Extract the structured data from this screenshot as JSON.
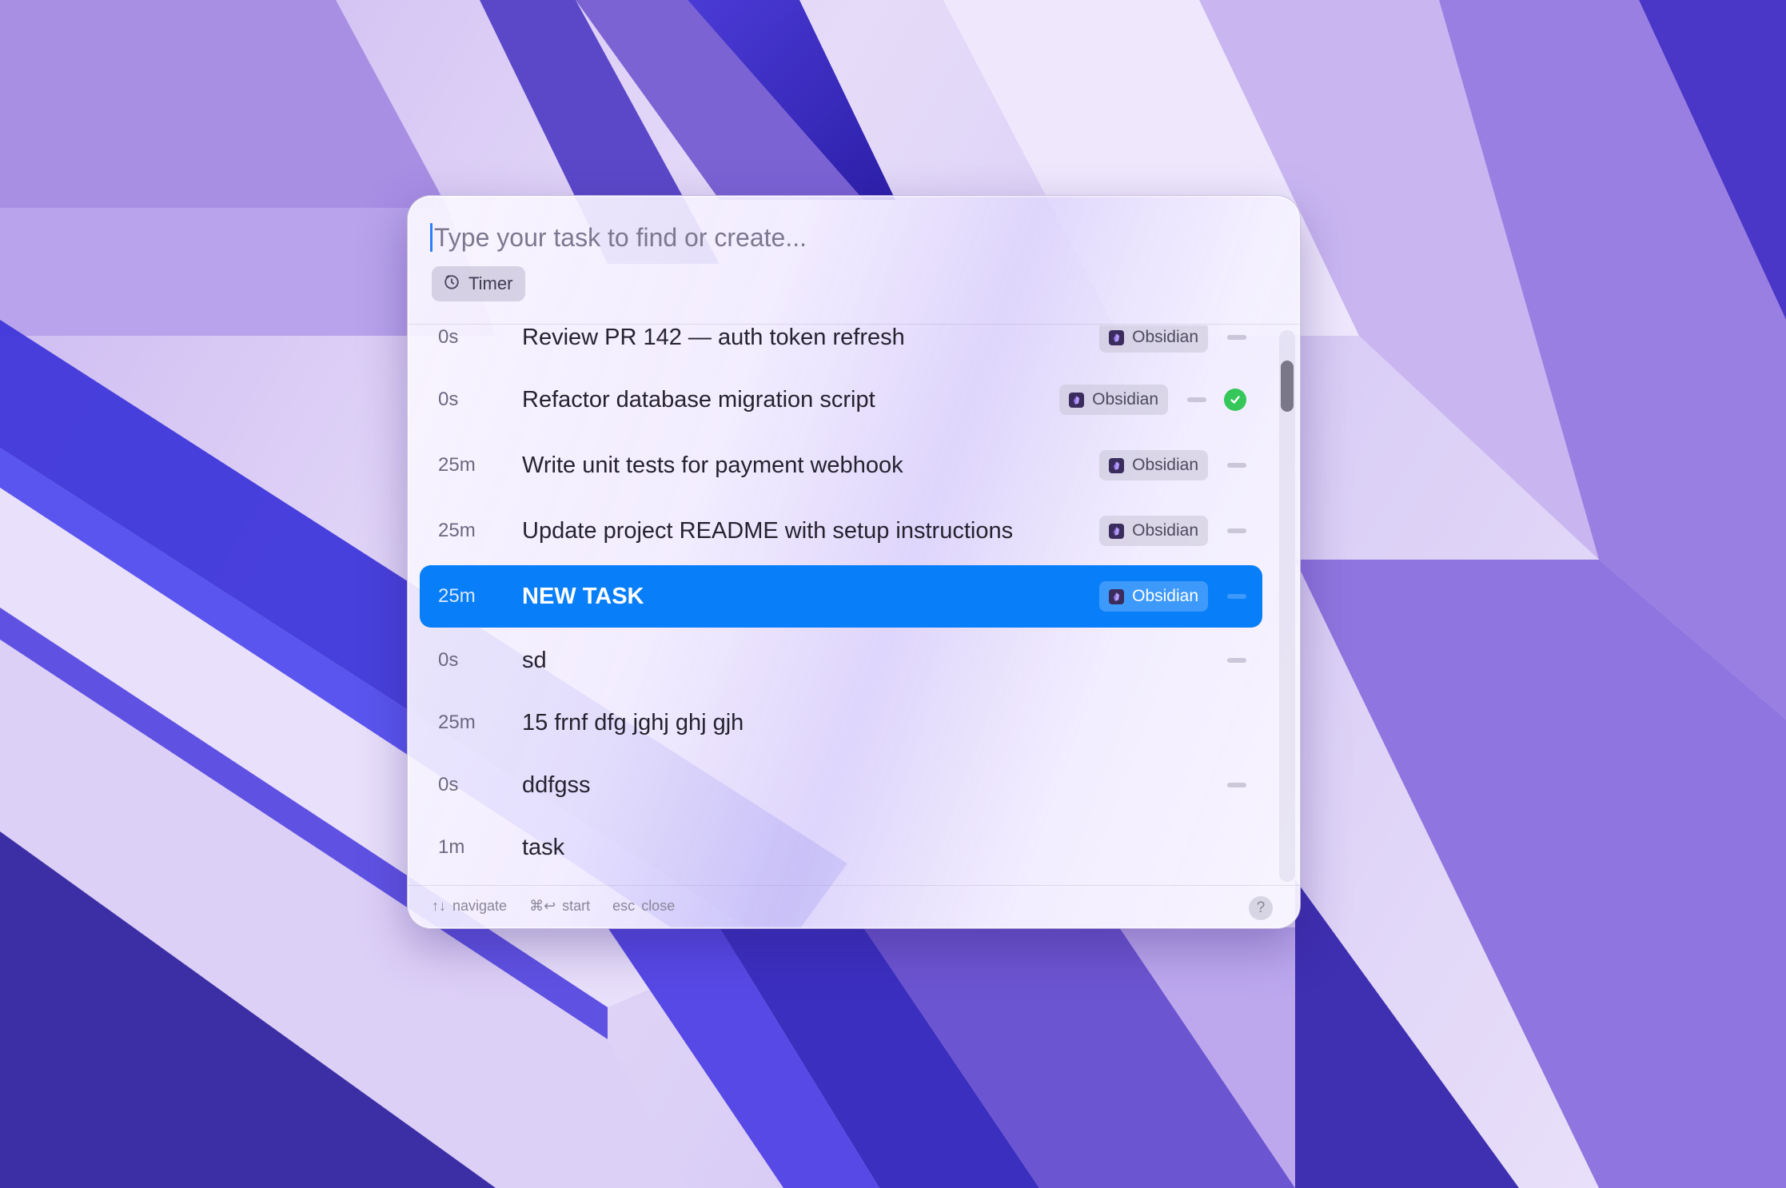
{
  "search": {
    "placeholder": "Type your task to find or create..."
  },
  "chip": {
    "label": "Timer",
    "icon": "timer-icon"
  },
  "tasks": [
    {
      "duration": "0s",
      "title": "Review PR 142 — auth token refresh",
      "tag": "Obsidian",
      "status": "dash"
    },
    {
      "duration": "0s",
      "title": "Refactor database migration script",
      "tag": "Obsidian",
      "status": "done"
    },
    {
      "duration": "25m",
      "title": "Write unit tests for payment webhook",
      "tag": "Obsidian",
      "status": "dash"
    },
    {
      "duration": "25m",
      "title": "Update project README with setup instructions",
      "tag": "Obsidian",
      "status": "dash"
    },
    {
      "duration": "25m",
      "title": "NEW TASK",
      "tag": "Obsidian",
      "status": "dash",
      "selected": true
    },
    {
      "duration": "0s",
      "title": "sd",
      "tag": "",
      "status": "dash"
    },
    {
      "duration": "25m",
      "title": "15 frnf dfg jghj ghj gjh",
      "tag": "",
      "status": "none"
    },
    {
      "duration": "0s",
      "title": "ddfgss",
      "tag": "",
      "status": "dash"
    },
    {
      "duration": "1m",
      "title": "task",
      "tag": "",
      "status": "none"
    }
  ],
  "footer": {
    "navigate_keys": "↑↓",
    "navigate_label": "navigate",
    "start_keys": "⌘↩",
    "start_label": "start",
    "close_keys": "esc",
    "close_label": "close",
    "help_label": "?"
  },
  "colors": {
    "selection": "#087ef9",
    "done_check": "#35c759",
    "caret": "#2f7ff7"
  }
}
